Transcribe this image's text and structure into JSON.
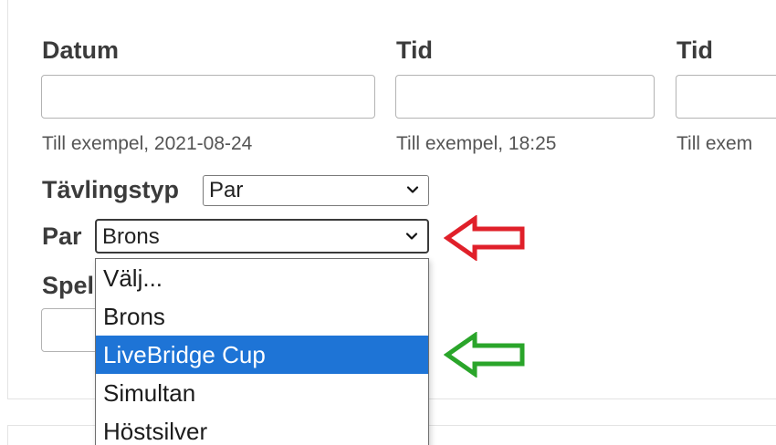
{
  "form": {
    "datum": {
      "label": "Datum",
      "value": "",
      "hint": "Till exempel, 2021-08-24"
    },
    "tid1": {
      "label": "Tid",
      "value": "",
      "hint": "Till exempel, 18:25"
    },
    "tid2": {
      "label": "Tid",
      "value": "",
      "hint": "Till exem"
    },
    "tavlingstyp": {
      "label": "Tävlingstyp",
      "selected": "Par"
    },
    "par": {
      "label": "Par",
      "selected": "Brons",
      "options": [
        "Välj...",
        "Brons",
        "LiveBridge Cup",
        "Simultan",
        "Höstsilver"
      ],
      "highlighted": "LiveBridge Cup"
    },
    "spel": {
      "label": "Spel",
      "value": ""
    }
  },
  "annotations": {
    "red_arrow_color": "#e0202a",
    "green_arrow_color": "#2aa52a"
  },
  "colors": {
    "highlight": "#1e74d6"
  }
}
